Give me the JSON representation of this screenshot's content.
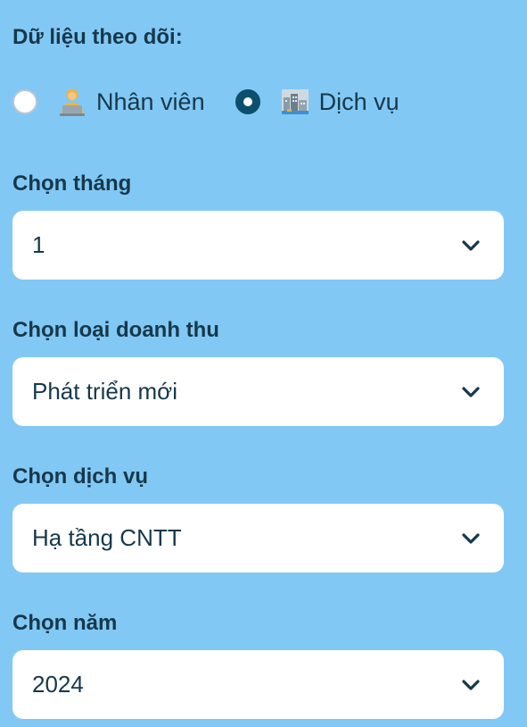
{
  "tracking": {
    "label": "Dữ liệu theo dõi:",
    "options": [
      {
        "label": "Nhân viên",
        "icon": "office-worker-icon",
        "checked": false
      },
      {
        "label": "Dịch vụ",
        "icon": "cityscape-icon",
        "checked": true
      }
    ]
  },
  "month": {
    "label": "Chọn tháng",
    "value": "1"
  },
  "revenue_type": {
    "label": "Chọn loại doanh thu",
    "value": "Phát triển mới"
  },
  "service": {
    "label": "Chọn dịch vụ",
    "value": "Hạ tầng CNTT"
  },
  "year": {
    "label": "Chọn năm",
    "value": "2024"
  },
  "colors": {
    "background": "#82c8f5",
    "accent": "#0b4f6c",
    "text": "#16384a",
    "field": "#ffffff"
  }
}
